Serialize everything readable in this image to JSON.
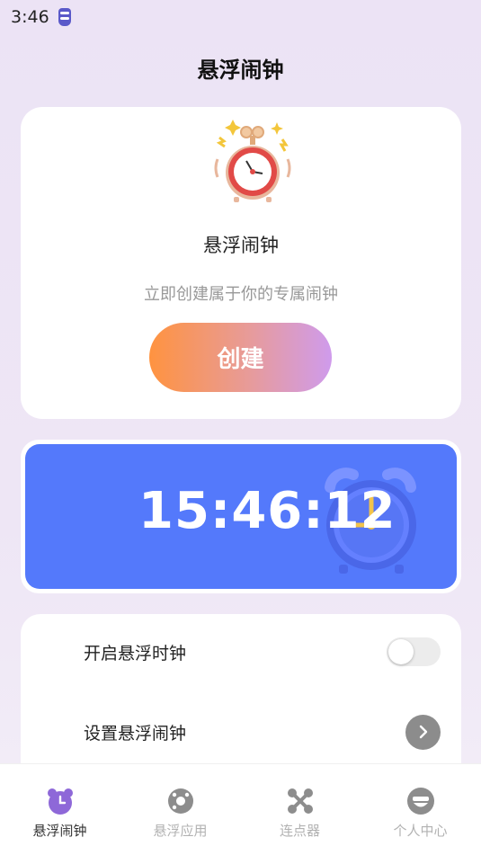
{
  "status_bar": {
    "time": "3:46"
  },
  "page": {
    "title": "悬浮闹钟"
  },
  "create_card": {
    "title": "悬浮闹钟",
    "subtitle": "立即创建属于你的专属闹钟",
    "button_label": "创建"
  },
  "clock_card": {
    "time": "15:46:12"
  },
  "settings": {
    "rows": [
      {
        "label": "开启悬浮时钟",
        "control": "toggle",
        "on": false
      },
      {
        "label": "设置悬浮闹钟",
        "control": "chevron-right-icon"
      }
    ]
  },
  "tabs": [
    {
      "label": "悬浮闹钟",
      "icon": "alarm-clock-icon",
      "active": true
    },
    {
      "label": "悬浮应用",
      "icon": "floating-app-icon",
      "active": false
    },
    {
      "label": "连点器",
      "icon": "auto-clicker-icon",
      "active": false
    },
    {
      "label": "个人中心",
      "icon": "profile-icon",
      "active": false
    }
  ],
  "colors": {
    "accent_blue": "#5479fb",
    "button_gradient_start": "#ff9340",
    "button_gradient_end": "#cf9bec",
    "active_tab": "#8e68d8"
  }
}
